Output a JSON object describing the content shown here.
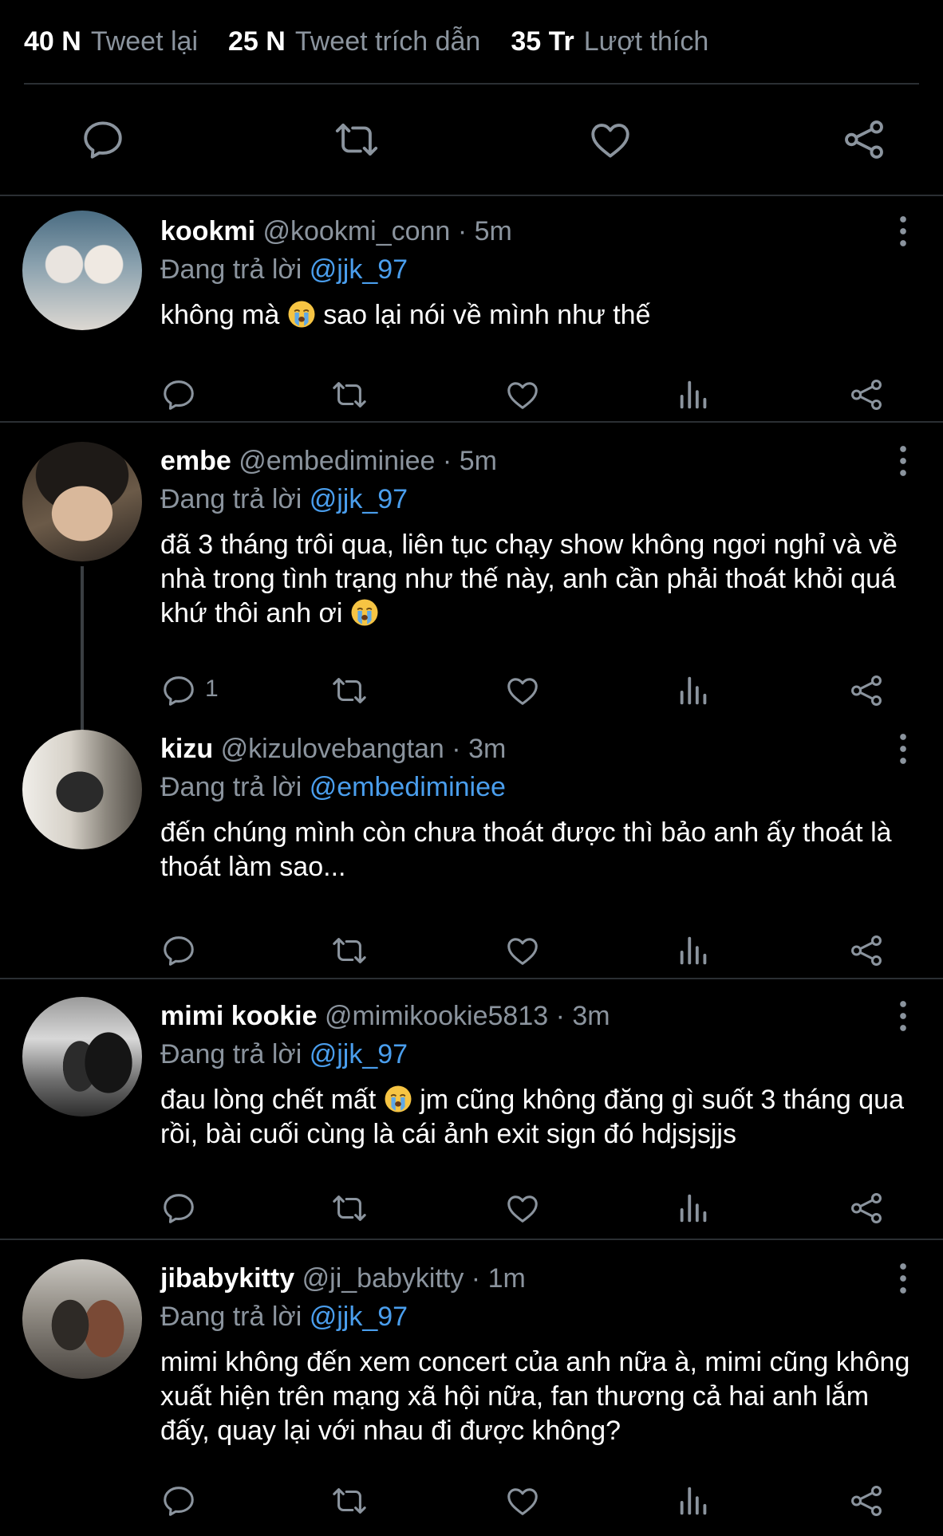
{
  "stats": [
    {
      "count": "40 N",
      "label": "Tweet lại"
    },
    {
      "count": "25 N",
      "label": "Tweet trích dẫn"
    },
    {
      "count": "35 Tr",
      "label": "Lượt thích"
    }
  ],
  "colors": {
    "background": "#000000",
    "text": "#ffffff",
    "muted": "#8b949e",
    "mention": "#4a9eed",
    "divider": "#2b2f33"
  },
  "icons": [
    "reply-icon",
    "retweet-icon",
    "like-icon",
    "share-icon",
    "views-icon",
    "more-icon",
    "crying-emoji"
  ],
  "replies": [
    {
      "name": "kookmi",
      "handle": "@kookmi_conn",
      "time": "5m",
      "replying_label": "Đang trả lời",
      "replying_to": "@jjk_97",
      "text_parts": [
        "không mà",
        "sao lại nói về mình như thế"
      ]
    },
    {
      "name": "embe",
      "handle": "@embediminiee",
      "time": "5m",
      "replying_label": "Đang trả lời",
      "replying_to": "@jjk_97",
      "text_parts": [
        "đã 3 tháng trôi qua, liên tục chạy show không ngơi nghỉ và về nhà trong tình trạng như thế này, anh cần phải thoát khỏi quá khứ thôi anh ơi",
        ""
      ],
      "reply_count": "1"
    },
    {
      "name": "kizu",
      "handle": "@kizulovebangtan",
      "time": "3m",
      "replying_label": "Đang trả lời",
      "replying_to": "@embediminiee",
      "text_parts": [
        "đến chúng mình còn chưa thoát được thì bảo anh ấy thoát là thoát làm sao..."
      ]
    },
    {
      "name": "mimi kookie",
      "handle": "@mimikookie5813",
      "time": "3m",
      "replying_label": "Đang trả lời",
      "replying_to": "@jjk_97",
      "text_parts": [
        "đau lòng chết mất",
        "jm cũng không đăng gì suốt 3 tháng qua rồi, bài cuối cùng là cái ảnh exit sign đó hdjsjsjjs"
      ]
    },
    {
      "name": "jibabykitty",
      "handle": "@ji_babykitty",
      "time": "1m",
      "replying_label": "Đang trả lời",
      "replying_to": "@jjk_97",
      "text_parts": [
        "mimi không đến xem concert của anh nữa à, mimi cũng không xuất hiện trên mạng xã hội nữa, fan thương cả hai anh lắm đấy, quay lại với nhau đi được không?"
      ]
    }
  ]
}
